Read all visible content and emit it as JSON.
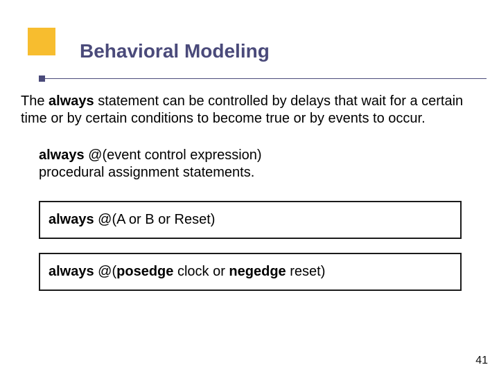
{
  "slide": {
    "title": "Behavioral Modeling",
    "page_number": "41",
    "paragraph": {
      "pre": "The ",
      "kw": "always",
      "post": " statement can be controlled by delays that wait for a certain time or by certain conditions to become true or by events to occur."
    },
    "syntax": {
      "kw": "always",
      "rest": " @(event control expression)",
      "line2": "procedural assignment statements."
    },
    "example1": {
      "kw": "always",
      "rest": " @(A or B or Reset)"
    },
    "example2": {
      "kw1": "always",
      "mid1": " @(",
      "kw2": "posedge",
      "mid2": " clock or ",
      "kw3": "negedge",
      "post": " reset)"
    }
  }
}
